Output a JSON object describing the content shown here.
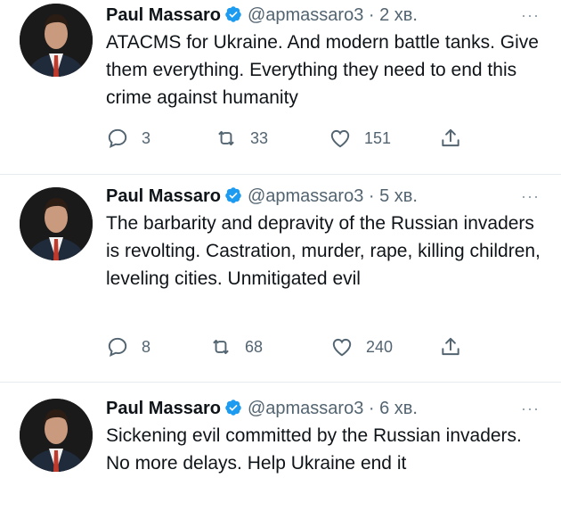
{
  "tweets": [
    {
      "author": "Paul Massaro",
      "handle": "@apmassaro3",
      "separator": "·",
      "time": "2 хв.",
      "more": "···",
      "text": "ATACMS for Ukraine. And modern battle tanks. Give them everything. Everything they need to end this crime against humanity",
      "replies": "3",
      "retweets": "33",
      "likes": "151"
    },
    {
      "author": "Paul Massaro",
      "handle": "@apmassaro3",
      "separator": "·",
      "time": "5 хв.",
      "more": "···",
      "text": "The barbarity and depravity of the Russian invaders is revolting. Castration, murder, rape, killing children, leveling cities. Unmitigated evil",
      "replies": "8",
      "retweets": "68",
      "likes": "240"
    },
    {
      "author": "Paul Massaro",
      "handle": "@apmassaro3",
      "separator": "·",
      "time": "6 хв.",
      "more": "···",
      "text": "Sickening evil committed by the Russian invaders. No more delays. Help Ukraine end it"
    }
  ],
  "colors": {
    "verified": "#1d9bf0",
    "muted": "#536471",
    "divider": "#e6ecf0",
    "text": "#0f1419"
  },
  "icons": [
    "verified-badge-icon",
    "reply-icon",
    "retweet-icon",
    "like-icon",
    "share-icon",
    "more-icon"
  ]
}
